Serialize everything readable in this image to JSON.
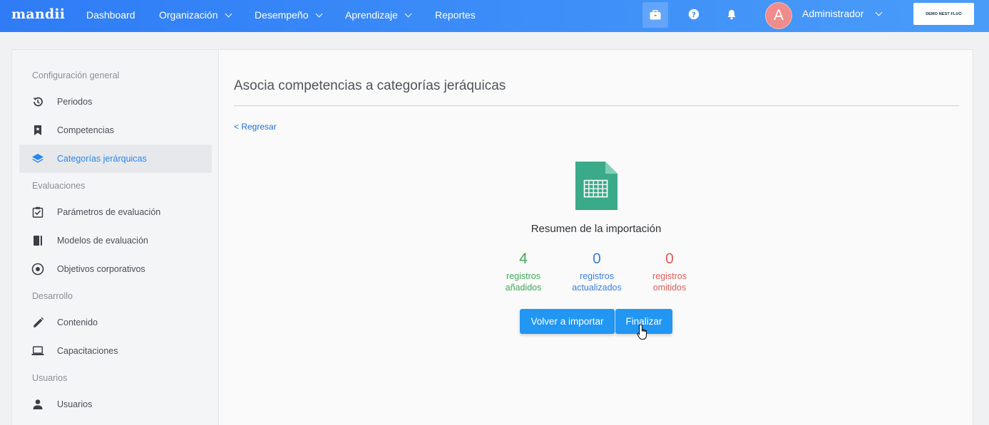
{
  "brand": "mandii",
  "nav": {
    "items": [
      {
        "label": "Dashboard",
        "dropdown": false
      },
      {
        "label": "Organización",
        "dropdown": true
      },
      {
        "label": "Desempeño",
        "dropdown": true
      },
      {
        "label": "Aprendizaje",
        "dropdown": true
      },
      {
        "label": "Reportes",
        "dropdown": false
      }
    ],
    "icons": [
      "briefcase-icon",
      "help-icon",
      "bell-icon"
    ],
    "avatar_initial": "A",
    "user": "Administrador",
    "company": "DEMO NEST FLUO"
  },
  "sidebar": {
    "sections": [
      {
        "title": "Configuración general",
        "items": [
          {
            "label": "Periodos",
            "icon": "history-icon"
          },
          {
            "label": "Competencias",
            "icon": "bookmark-star-icon"
          },
          {
            "label": "Categorías jerárquicas",
            "icon": "layers-icon",
            "active": true
          }
        ]
      },
      {
        "title": "Evaluaciones",
        "items": [
          {
            "label": "Parámetros de evaluación",
            "icon": "checkbox-icon"
          },
          {
            "label": "Modelos de evaluación",
            "icon": "book-icon"
          },
          {
            "label": "Objetivos corporativos",
            "icon": "target-icon"
          }
        ]
      },
      {
        "title": "Desarrollo",
        "items": [
          {
            "label": "Contenido",
            "icon": "pencil-icon"
          },
          {
            "label": "Capacitaciones",
            "icon": "laptop-icon"
          }
        ]
      },
      {
        "title": "Usuarios",
        "items": [
          {
            "label": "Usuarios",
            "icon": "user-icon"
          }
        ]
      }
    ]
  },
  "main": {
    "title": "Asocia competencias a categorías jeráquicas",
    "back_label": "< Regresar",
    "summary_title": "Resumen de la importación",
    "stats": [
      {
        "value": "4",
        "line1": "registros",
        "line2": "añadidos",
        "color": "#43a85a"
      },
      {
        "value": "0",
        "line1": "registros",
        "line2": "actualizados",
        "color": "#3b7de0"
      },
      {
        "value": "0",
        "line1": "registros",
        "line2": "omitidos",
        "color": "#e25b5b"
      }
    ],
    "reimport_label": "Volver a importar",
    "finish_label": "Finalizar"
  },
  "colors": {
    "accent": "#2196f3",
    "topbar": "#3d8ef8",
    "file_icon": "#3aaa8a"
  }
}
